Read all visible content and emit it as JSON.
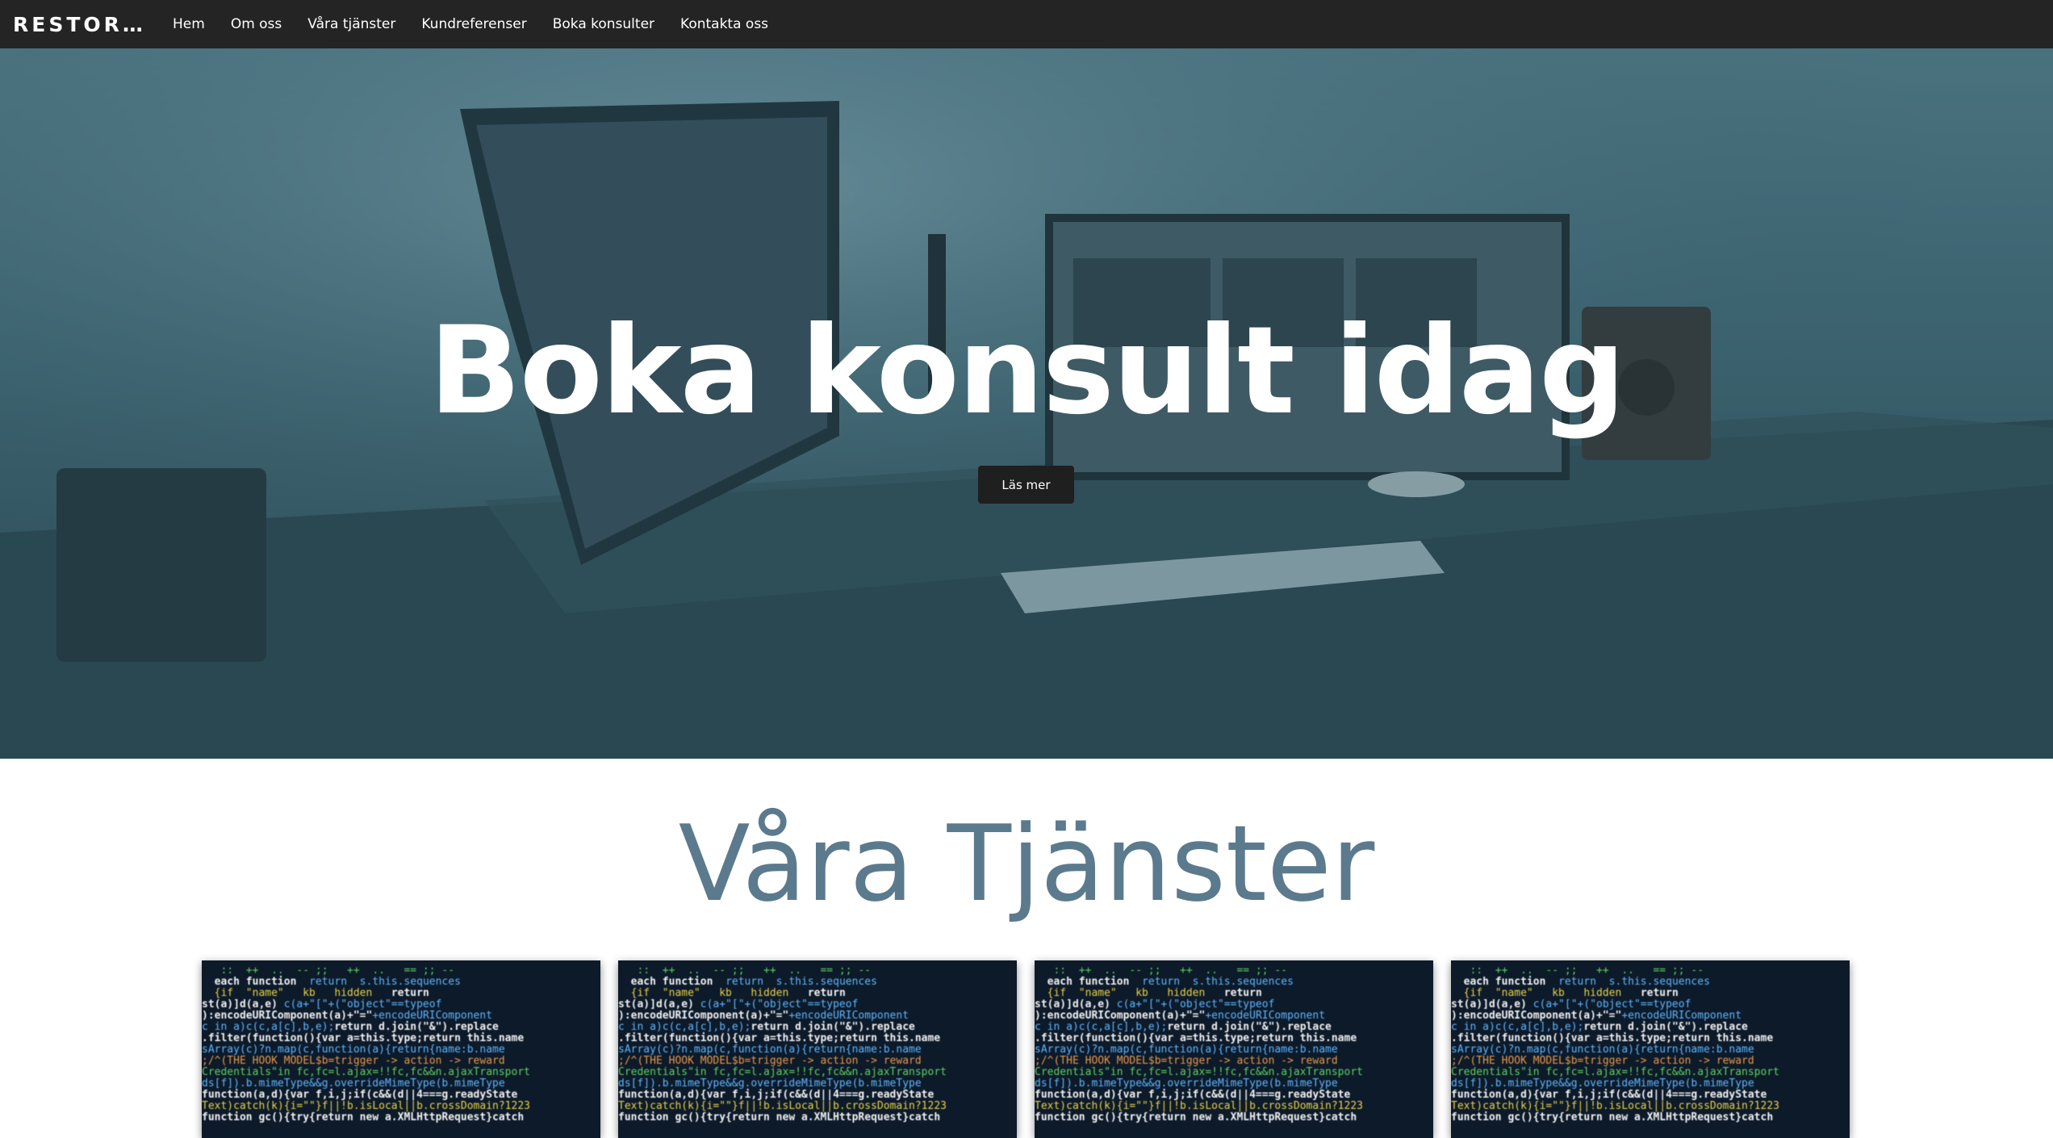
{
  "navbar": {
    "brand": "RESTOR…",
    "links": [
      "Hem",
      "Om oss",
      "Våra tjänster",
      "Kundreferenser",
      "Boka konsulter",
      "Kontakta oss"
    ]
  },
  "hero": {
    "title": "Boka konsult idag",
    "button_label": "Läs mer",
    "background_icon": "desk-workstation-photo"
  },
  "services": {
    "title": "Våra Tjänster",
    "card_image": "code-screen-photo"
  },
  "colors": {
    "navbar_bg": "#242424",
    "hero_tint": "#436f7c",
    "services_title": "#5b7a8e",
    "button_bg": "#1f1f1f"
  }
}
